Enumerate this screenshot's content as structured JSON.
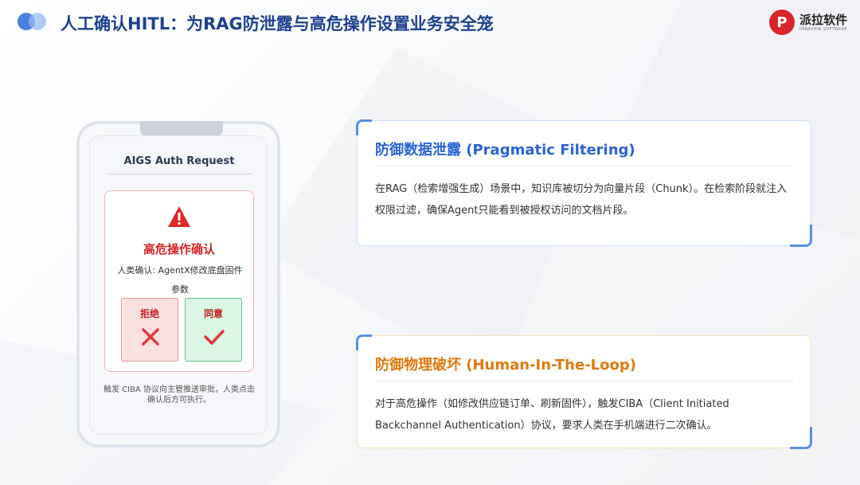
{
  "header": {
    "title": "人工确认HITL：为RAG防泄露与高危操作设置业务安全笼",
    "logo": {
      "name": "派拉软件",
      "subtitle": "PARAVIEW SOFTWARE"
    }
  },
  "phone": {
    "auth_title": "AIGS Auth Request",
    "alert": {
      "icon": "warning-triangle-icon",
      "heading": "高危操作确认",
      "text": "人类确认: AgentX修改底盘固件参数"
    },
    "buttons": {
      "reject": {
        "label": "拒绝",
        "icon": "x-icon",
        "color": "#e03b3b"
      },
      "accept": {
        "label": "同意",
        "icon": "check-icon",
        "color": "#e03b3b"
      }
    },
    "note": "触发 CIBA 协议向主管推送审批，人类点击确认后方可执行。"
  },
  "cards": [
    {
      "heading": "防御数据泄露 (Pragmatic Filtering)",
      "body": "在RAG（检索增强生成）场景中，知识库被切分为向量片段（Chunk）。在检索阶段就注入权限过滤，确保Agent只能看到被授权访问的文档片段。",
      "accent": "#2a63d8"
    },
    {
      "heading": "防御物理破坏 (Human-In-The-Loop)",
      "body": "对于高危操作（如修改供应链订单、刷新固件），触发CIBA（Client Initiated Backchannel Authentication）协议，要求人类在手机端进行二次确认。",
      "accent": "#e07a10"
    }
  ]
}
